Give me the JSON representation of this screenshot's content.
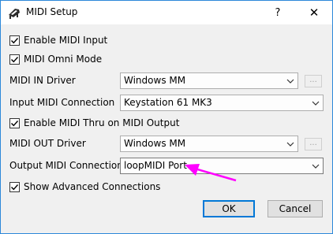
{
  "window": {
    "title": "MIDI Setup",
    "help_label": "?",
    "close_label": "✕"
  },
  "options": {
    "enable_midi_input": {
      "label": "Enable MIDI Input",
      "checked": true
    },
    "midi_omni_mode": {
      "label": "MIDI Omni Mode",
      "checked": true
    },
    "enable_midi_thru": {
      "label": "Enable MIDI Thru on MIDI Output",
      "checked": true
    },
    "show_advanced": {
      "label": "Show Advanced Connections",
      "checked": true
    }
  },
  "fields": {
    "midi_in_driver": {
      "label": "MIDI IN Driver",
      "value": "Windows MM",
      "browse_label": "..."
    },
    "input_midi_connection": {
      "label": "Input MIDI Connection",
      "value": "Keystation 61 MK3"
    },
    "midi_out_driver": {
      "label": "MIDI OUT Driver",
      "value": "Windows MM",
      "browse_label": "..."
    },
    "output_midi_connection": {
      "label": "Output MIDI Connection",
      "value": "loopMIDI Port"
    }
  },
  "buttons": {
    "ok": "OK",
    "cancel": "Cancel"
  },
  "colors": {
    "annotation_arrow": "#ff00ff",
    "window_border": "#2c88d9",
    "default_button_border": "#0078d7"
  }
}
